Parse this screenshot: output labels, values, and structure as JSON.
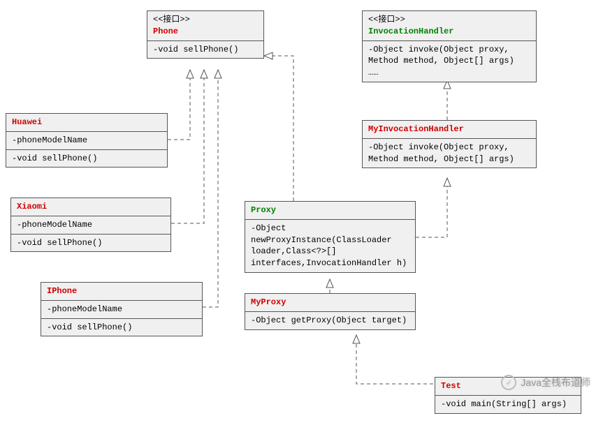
{
  "classes": {
    "phone": {
      "stereotype": "<<接口>>",
      "name": "Phone",
      "nameColor": "red",
      "attrs": "",
      "ops": "-void sellPhone()"
    },
    "invocationHandler": {
      "stereotype": "<<接口>>",
      "name": "InvocationHandler",
      "nameColor": "green",
      "attrs": "",
      "ops": "-Object invoke(Object proxy,\nMethod method, Object[] args)\n……"
    },
    "huawei": {
      "name": "Huawei",
      "nameColor": "red",
      "attrs": "-phoneModelName",
      "ops": "-void sellPhone()"
    },
    "xiaomi": {
      "name": "Xiaomi",
      "nameColor": "red",
      "attrs": "-phoneModelName",
      "ops": "-void sellPhone()"
    },
    "iphone": {
      "name": "IPhone",
      "nameColor": "red",
      "attrs": "-phoneModelName",
      "ops": "-void sellPhone()"
    },
    "myInvocationHandler": {
      "name": "MyInvocationHandler",
      "nameColor": "red",
      "attrs": "",
      "ops": "-Object invoke(Object proxy,\nMethod method, Object[] args)"
    },
    "proxy": {
      "name": "Proxy",
      "nameColor": "green",
      "attrs": "",
      "ops": "-Object\nnewProxyInstance(ClassLoader\nloader,Class<?>[]\ninterfaces,InvocationHandler h)"
    },
    "myProxy": {
      "name": "MyProxy",
      "nameColor": "red",
      "attrs": "",
      "ops": "-Object getProxy(Object target)"
    },
    "test": {
      "name": "Test",
      "nameColor": "red",
      "attrs": "",
      "ops": "-void main(String[] args)"
    }
  },
  "watermark": "Java全栈布道师"
}
